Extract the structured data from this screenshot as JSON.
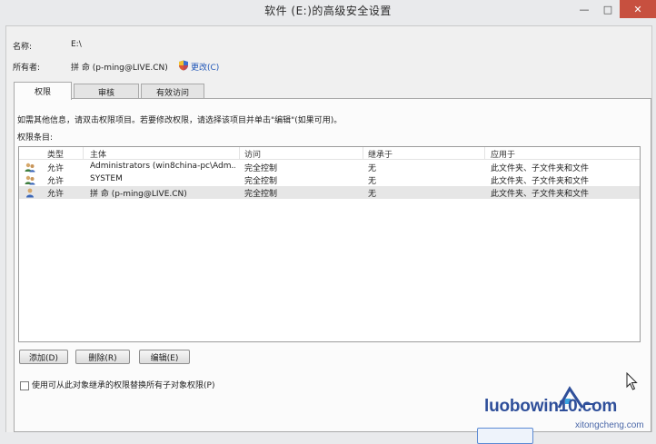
{
  "window": {
    "title": "软件 (E:)的高级安全设置",
    "minimize_label": "—",
    "maximize_label": "□",
    "close_label": "✕"
  },
  "fields": {
    "name_label": "名称:",
    "name_value": "E:\\",
    "owner_label": "所有者:",
    "owner_value": "拼 命 (p-ming@LIVE.CN)",
    "change_label": "更改(C)"
  },
  "tabs": [
    {
      "label": "权限"
    },
    {
      "label": "审核"
    },
    {
      "label": "有效访问"
    }
  ],
  "info_text": "如需其他信息，请双击权限项目。若要修改权限，请选择该项目并单击\"编辑\"(如果可用)。",
  "entries_label": "权限条目:",
  "columns": [
    "类型",
    "主体",
    "访问",
    "继承于",
    "应用于"
  ],
  "entries": [
    {
      "icon": "users-group-icon",
      "type": "允许",
      "principal": "Administrators (win8china-pc\\Adm...",
      "access": "完全控制",
      "inherited": "无",
      "applies": "此文件夹、子文件夹和文件"
    },
    {
      "icon": "users-group-icon",
      "type": "允许",
      "principal": "SYSTEM",
      "access": "完全控制",
      "inherited": "无",
      "applies": "此文件夹、子文件夹和文件"
    },
    {
      "icon": "user-icon",
      "type": "允许",
      "principal": "拼 命 (p-ming@LIVE.CN)",
      "access": "完全控制",
      "inherited": "无",
      "applies": "此文件夹、子文件夹和文件"
    }
  ],
  "buttons": {
    "add": "添加(D)",
    "remove": "删除(R)",
    "edit": "编辑(E)"
  },
  "replace_checkbox": {
    "label": "使用可从此对象继承的权限替换所有子对象权限(P)",
    "checked": false
  },
  "watermark": {
    "main": "luobowin10.com",
    "sub": "xitongcheng.com"
  },
  "colors": {
    "link": "#1f55b7",
    "close_button": "#c7503f",
    "watermark": "#2f4f9a"
  }
}
